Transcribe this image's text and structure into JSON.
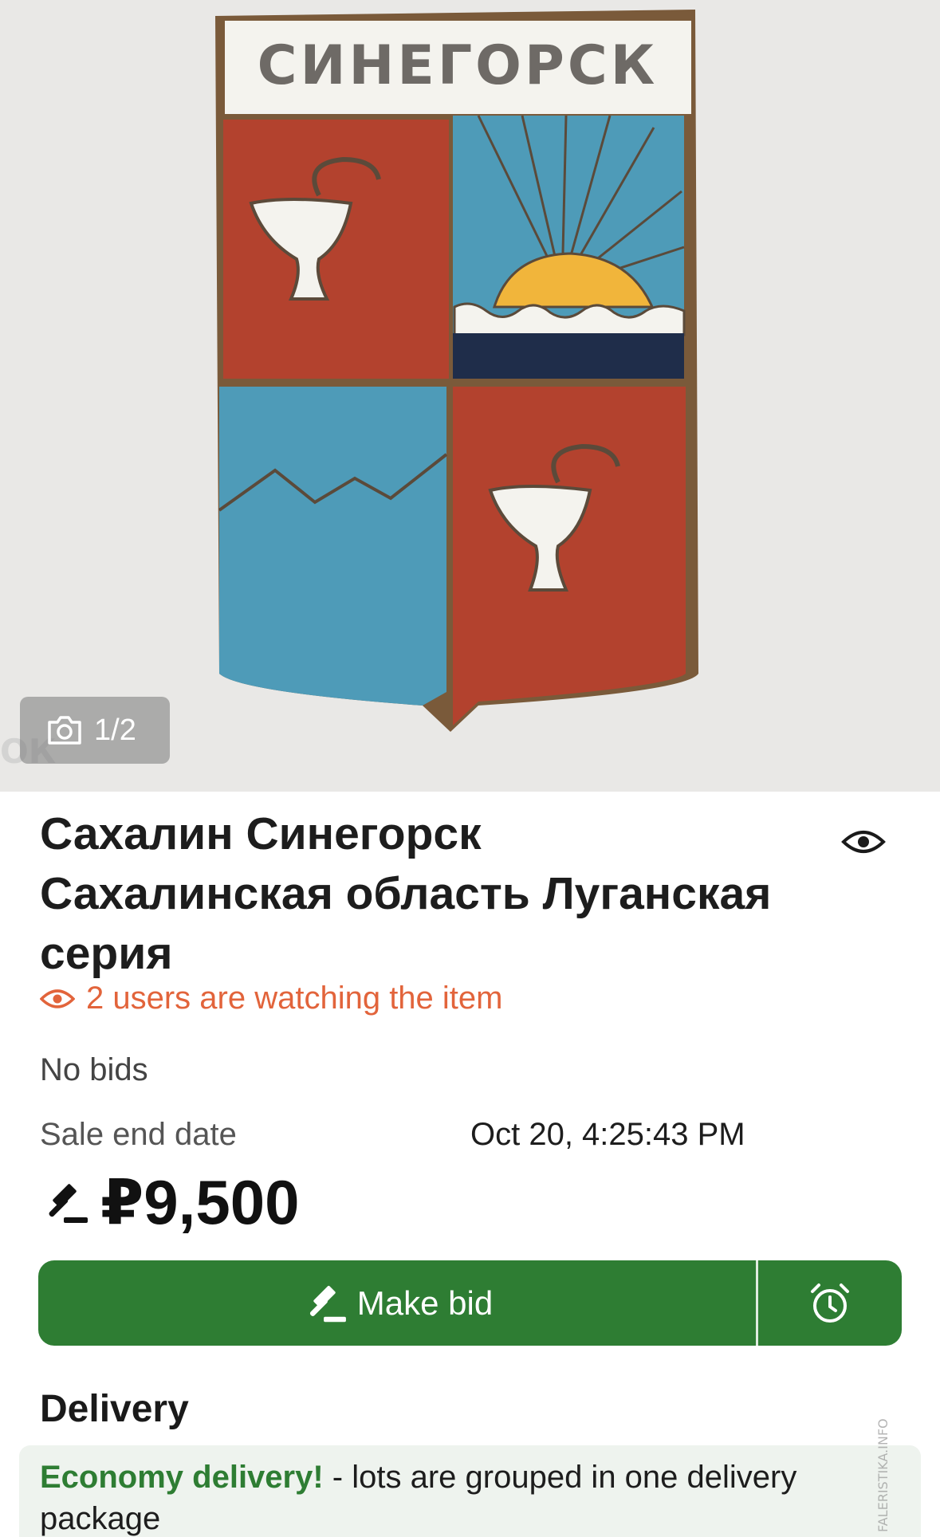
{
  "photo": {
    "badge_text": "СИНЕГОРСК",
    "counter": "1/2",
    "watermark": "ОК",
    "camera_icon": "camera-icon"
  },
  "listing": {
    "title": "Сахалин Синегорск Сахалинская область Луганская серия",
    "watchers_text": "2 users are watching the item",
    "bids_text": "No bids",
    "end_label": "Sale end date",
    "end_value": "Oct 20, 4:25:43 PM",
    "price": "₽9,500"
  },
  "actions": {
    "bid_label": "Make bid",
    "bid_icon": "gavel-icon",
    "reminder_icon": "alarm-clock-icon",
    "watch_icon": "eye-icon"
  },
  "delivery": {
    "heading": "Delivery",
    "highlight": "Economy delivery!",
    "text": " - lots are grouped in one delivery package"
  },
  "side_watermark": "FALERISTIKA.INFO",
  "colors": {
    "accent_green": "#2e7d33",
    "watchers_orange": "#e2643b",
    "delivery_bg": "#eef3ee"
  }
}
